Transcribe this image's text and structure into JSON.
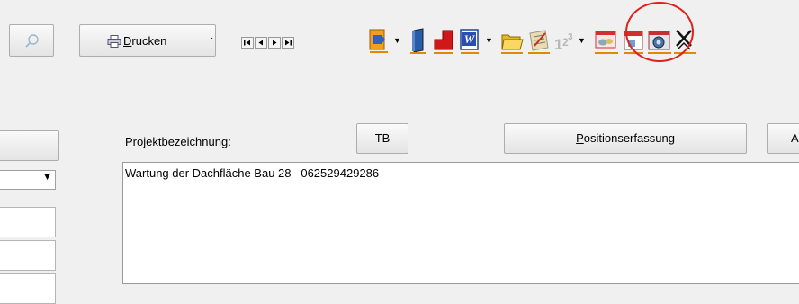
{
  "toolbar": {
    "print_label": "Drucken",
    "print_underline_letter": "D",
    "print_rest": "rucken",
    "icons": [
      "search-icon",
      "printer-icon",
      "nav-first-icon",
      "nav-prev-icon",
      "nav-next-icon",
      "nav-last-icon",
      "export-icon",
      "door-icon",
      "red-block-icon",
      "word-icon",
      "folder-icon",
      "notes-icon",
      "numbering-icon",
      "gallery-icon",
      "calendar-icon",
      "photo-icon",
      "close-x-icon"
    ]
  },
  "buttons": {
    "tb_label": "TB",
    "positionserfassung_first": "P",
    "positionserfassung_rest": "ositionserfassung",
    "positionserfassung_label": "Positionserfassung",
    "a_label": "A"
  },
  "form": {
    "projektbezeichnung_label": "Projektbezeichnung:",
    "projektbezeichnung_value": "Wartung der Dachfläche Bau 28   062529429286"
  },
  "annotation_color": "#e0201a"
}
